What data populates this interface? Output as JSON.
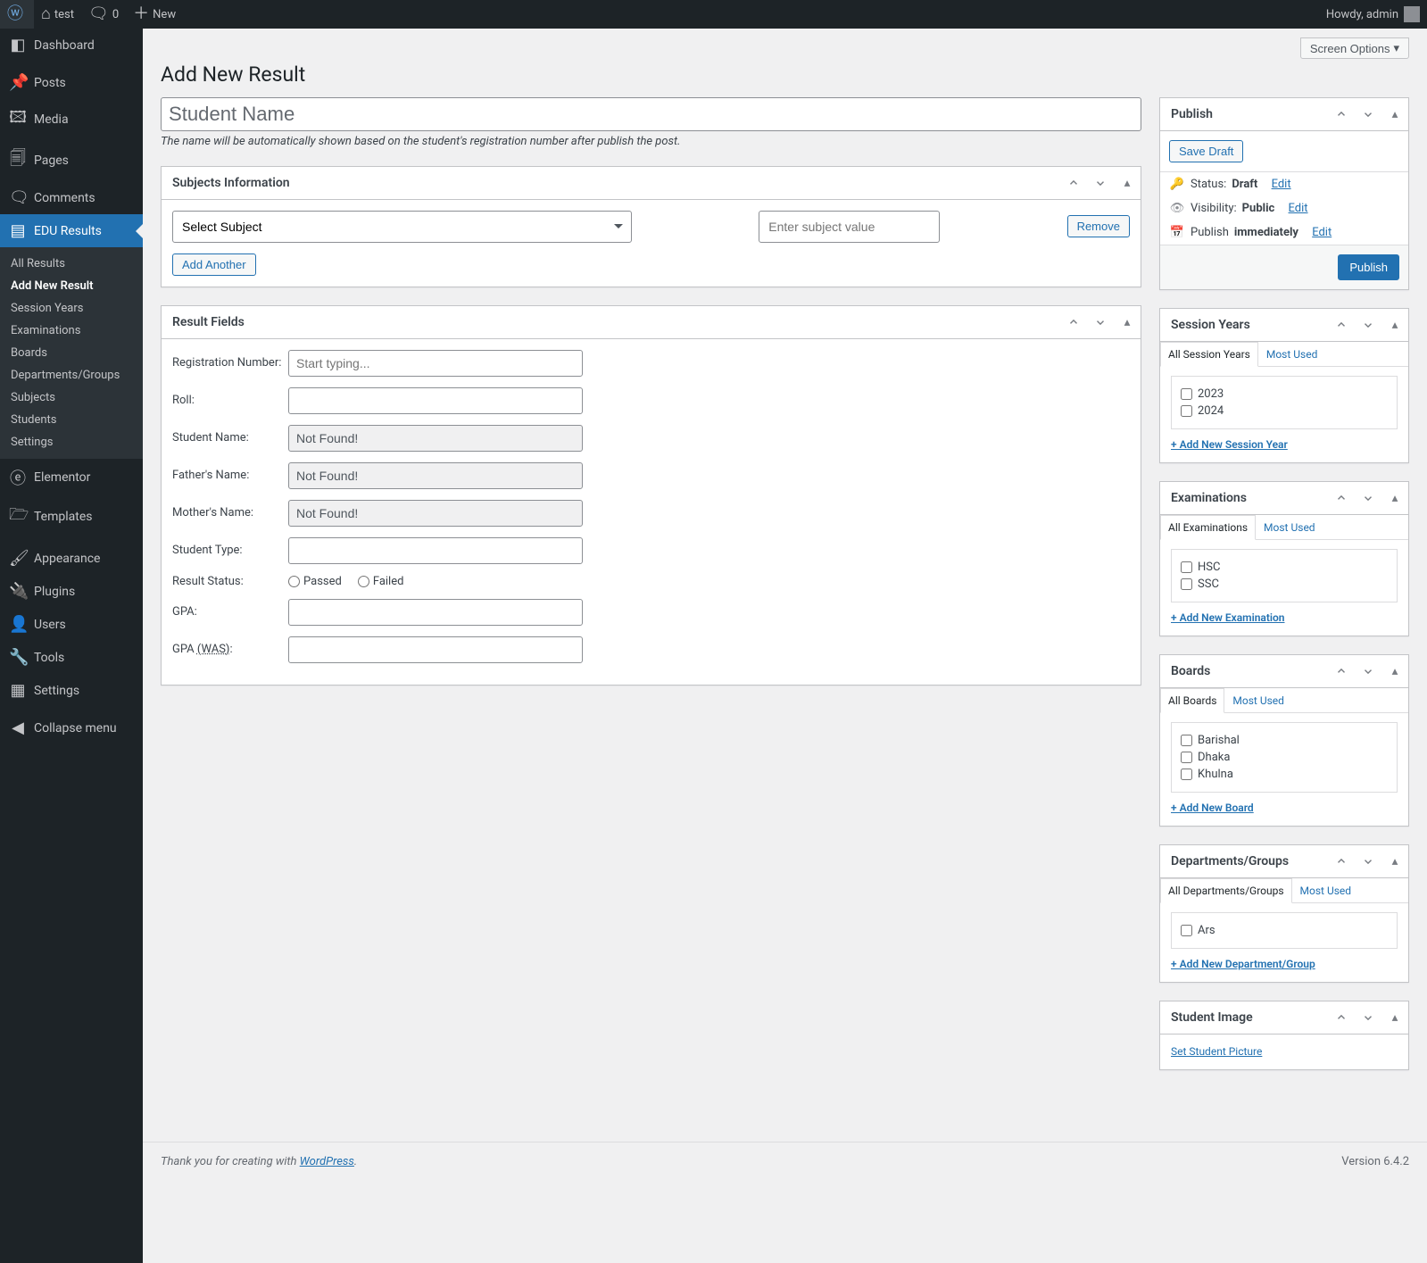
{
  "adminbar": {
    "site_name": "test",
    "comments": "0",
    "new": "New",
    "howdy": "Howdy, admin"
  },
  "menu": {
    "dashboard": "Dashboard",
    "posts": "Posts",
    "media": "Media",
    "pages": "Pages",
    "comments": "Comments",
    "edu_results": "EDU Results",
    "submenu": {
      "all_results": "All Results",
      "add_new": "Add New Result",
      "session_years": "Session Years",
      "examinations": "Examinations",
      "boards": "Boards",
      "departments": "Departments/Groups",
      "subjects": "Subjects",
      "students": "Students",
      "settings": "Settings"
    },
    "elementor": "Elementor",
    "templates": "Templates",
    "appearance": "Appearance",
    "plugins": "Plugins",
    "users": "Users",
    "tools": "Tools",
    "settings": "Settings",
    "collapse": "Collapse menu"
  },
  "screen_options": "Screen Options",
  "page_title": "Add New Result",
  "title_placeholder": "Student Name",
  "title_desc": "The name will be automatically shown based on the student's registration number after publish the post.",
  "subjects_box": {
    "title": "Subjects Information",
    "select_placeholder": "Select Subject",
    "value_placeholder": "Enter subject value",
    "remove": "Remove",
    "add_another": "Add Another"
  },
  "result_fields": {
    "title": "Result Fields",
    "reg_label": "Registration Number:",
    "reg_placeholder": "Start typing...",
    "roll_label": "Roll:",
    "student_name_label": "Student Name:",
    "student_name_value": "Not Found!",
    "father_label": "Father's Name:",
    "father_value": "Not Found!",
    "mother_label": "Mother's Name:",
    "mother_value": "Not Found!",
    "student_type_label": "Student Type:",
    "result_status_label": "Result Status:",
    "status_passed": "Passed",
    "status_failed": "Failed",
    "gpa_label": "GPA:",
    "gpa_was_prefix": "GPA ",
    "gpa_was_abbr": "(WAS)",
    "gpa_was_suffix": ":"
  },
  "publish": {
    "title": "Publish",
    "save_draft": "Save Draft",
    "status_label": "Status: ",
    "status_value": "Draft",
    "visibility_label": "Visibility: ",
    "visibility_value": "Public",
    "publish_label": "Publish ",
    "publish_value": "immediately",
    "edit": "Edit",
    "publish_btn": "Publish"
  },
  "session_years": {
    "title": "Session Years",
    "tab_all": "All Session Years",
    "tab_most": "Most Used",
    "items": [
      "2023",
      "2024"
    ],
    "add_new": "+ Add New Session Year"
  },
  "examinations": {
    "title": "Examinations",
    "tab_all": "All Examinations",
    "tab_most": "Most Used",
    "items": [
      "HSC",
      "SSC"
    ],
    "add_new": "+ Add New Examination"
  },
  "boards": {
    "title": "Boards",
    "tab_all": "All Boards",
    "tab_most": "Most Used",
    "items": [
      "Barishal",
      "Dhaka",
      "Khulna"
    ],
    "add_new": "+ Add New Board"
  },
  "departments": {
    "title": "Departments/Groups",
    "tab_all": "All Departments/Groups",
    "tab_most": "Most Used",
    "items": [
      "Ars"
    ],
    "add_new": "+ Add New Department/Group"
  },
  "student_image": {
    "title": "Student Image",
    "set_link": "Set Student Picture"
  },
  "footer": {
    "thanks_prefix": "Thank you for creating with ",
    "wp": "WordPress",
    "thanks_suffix": ".",
    "version": "Version 6.4.2"
  }
}
